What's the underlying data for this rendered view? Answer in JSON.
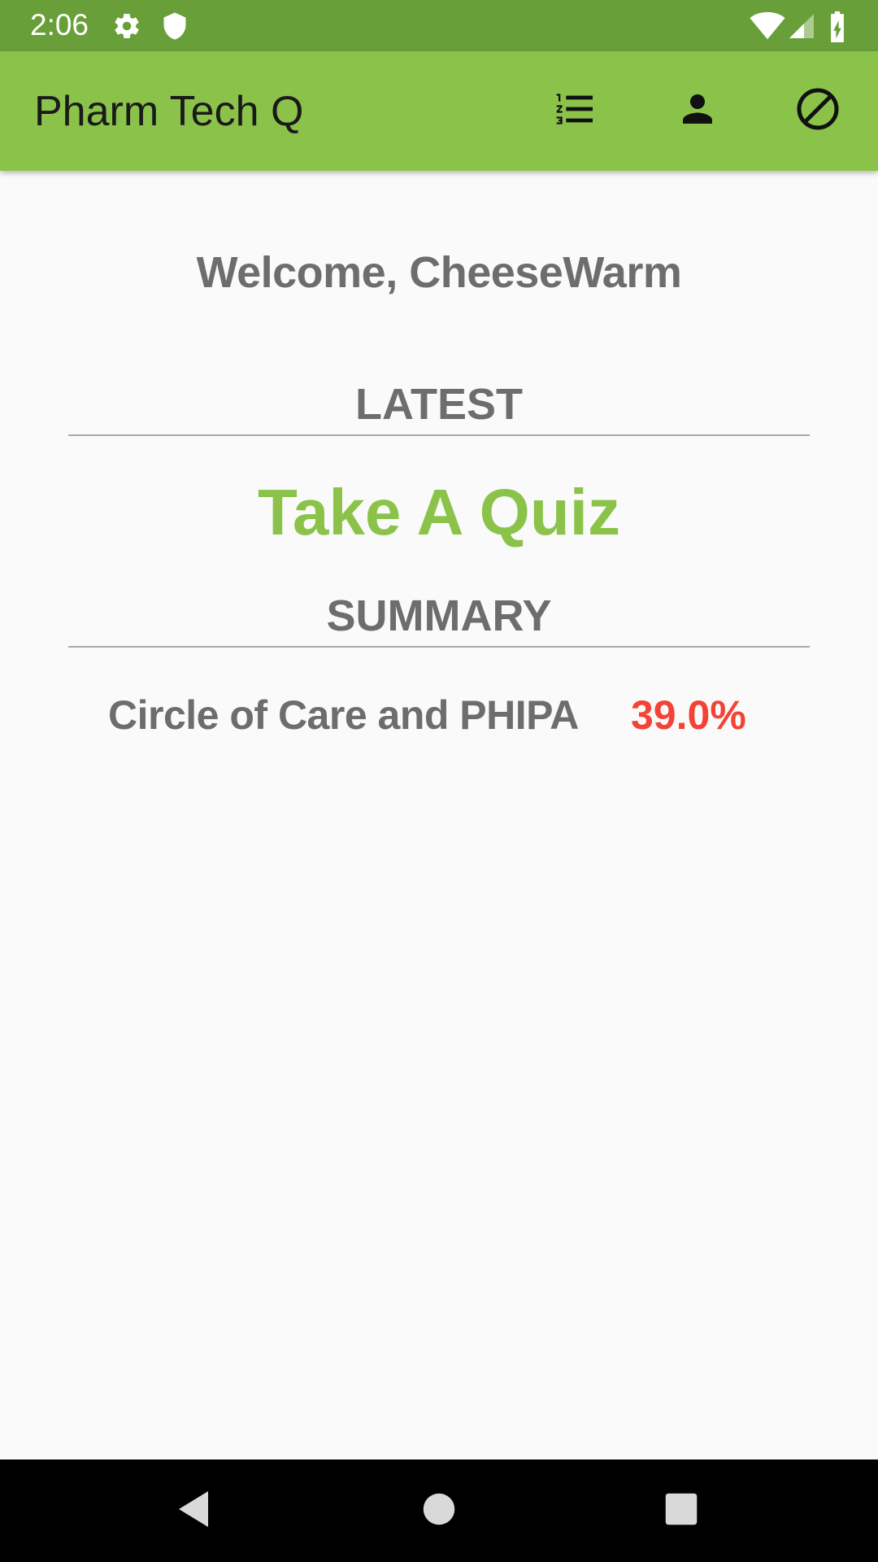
{
  "status_bar": {
    "time": "2:06",
    "icons": [
      "gear-icon",
      "shield-icon",
      "wifi-icon",
      "signal-icon",
      "battery-charging-icon"
    ]
  },
  "app_bar": {
    "title": "Pharm Tech Q",
    "actions": [
      "numbered-list-icon",
      "person-icon",
      "block-icon"
    ]
  },
  "main": {
    "welcome": "Welcome, CheeseWarm",
    "latest_label": "LATEST",
    "take_quiz_label": "Take A Quiz",
    "summary_label": "SUMMARY",
    "summary_items": [
      {
        "name": "Circle of Care and PHIPA",
        "score": "39.0%"
      }
    ]
  },
  "nav_bar": {
    "buttons": [
      "back-icon",
      "home-icon",
      "recents-icon"
    ]
  },
  "colors": {
    "status_bar": "#689F38",
    "app_bar": "#8BC34A",
    "accent": "#8BC34A",
    "score_bad": "#F44336",
    "text_secondary": "#6d6d6d"
  }
}
